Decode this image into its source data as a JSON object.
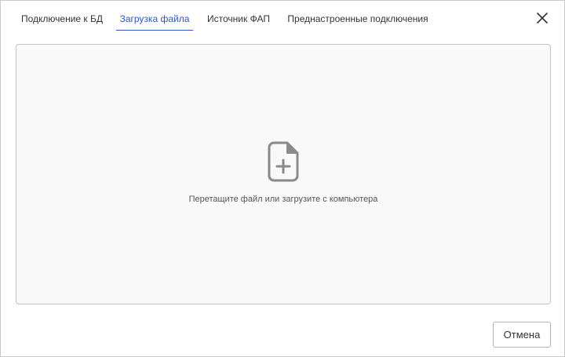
{
  "tabs": [
    {
      "label": "Подключение к БД",
      "active": false
    },
    {
      "label": "Загрузка файла",
      "active": true
    },
    {
      "label": "Источник ФАП",
      "active": false
    },
    {
      "label": "Преднастроенные подключения",
      "active": false
    }
  ],
  "close_icon": "close-icon",
  "dropzone": {
    "icon": "file-add-icon",
    "hint": "Перетащите файл или загрузите с компьютера"
  },
  "footer": {
    "cancel_label": "Отмена"
  },
  "colors": {
    "accent": "#2f58c5",
    "text": "#333333",
    "dropzone_bg": "#f9f9f9",
    "icon": "#8a8a8a"
  }
}
